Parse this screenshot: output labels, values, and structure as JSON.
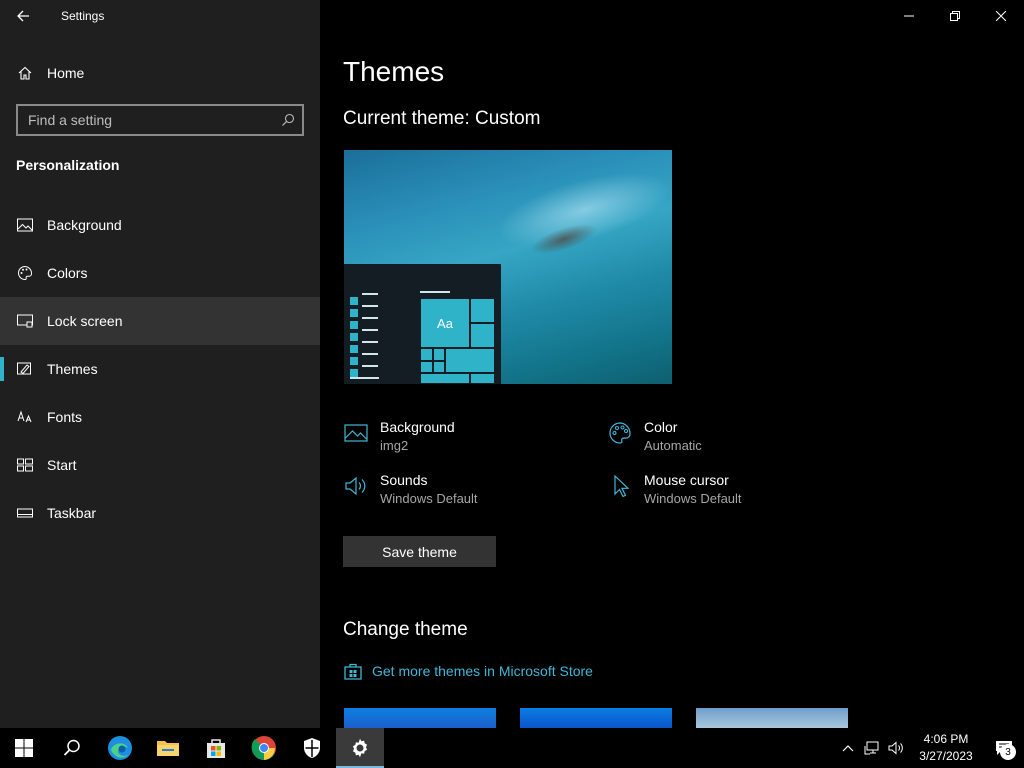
{
  "window": {
    "title": "Settings"
  },
  "sidebar": {
    "home_label": "Home",
    "search_placeholder": "Find a setting",
    "section_title": "Personalization",
    "items": [
      {
        "label": "Background",
        "icon": "image-icon"
      },
      {
        "label": "Colors",
        "icon": "palette-icon"
      },
      {
        "label": "Lock screen",
        "icon": "lock-screen-icon",
        "state": "hover"
      },
      {
        "label": "Themes",
        "icon": "themes-brush-icon",
        "state": "selected"
      },
      {
        "label": "Fonts",
        "icon": "fonts-icon"
      },
      {
        "label": "Start",
        "icon": "start-icon"
      },
      {
        "label": "Taskbar",
        "icon": "taskbar-icon"
      }
    ]
  },
  "main": {
    "page_title": "Themes",
    "current_theme": "Current theme: Custom",
    "preview_tile_label": "Aa",
    "properties": [
      {
        "label": "Background",
        "value": "img2",
        "icon": "image-icon"
      },
      {
        "label": "Color",
        "value": "Automatic",
        "icon": "palette-icon"
      },
      {
        "label": "Sounds",
        "value": "Windows Default",
        "icon": "speaker-icon"
      },
      {
        "label": "Mouse cursor",
        "value": "Windows Default",
        "icon": "cursor-icon"
      }
    ],
    "save_button": "Save theme",
    "change_theme_title": "Change theme",
    "store_link": "Get more themes in Microsoft Store"
  },
  "taskbar": {
    "apps": [
      "start-icon",
      "search-icon",
      "edge-icon",
      "file-explorer-icon",
      "microsoft-store-icon",
      "chrome-icon",
      "security-icon",
      "settings-icon"
    ],
    "active_app": "settings-icon",
    "time": "4:06 PM",
    "date": "3/27/2023",
    "notification_count": "3"
  },
  "colors": {
    "accent": "#2eb3c8",
    "link": "#3fb7d6",
    "sidebar_bg": "#1f1f1f",
    "main_bg": "#000000"
  }
}
